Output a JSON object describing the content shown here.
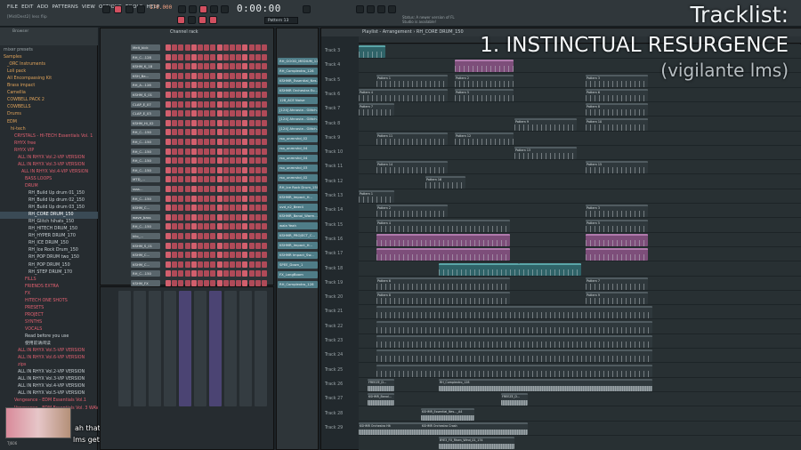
{
  "menubar": {
    "items": [
      "FILE",
      "EDIT",
      "ADD",
      "PATTERNS",
      "VIEW",
      "OPTIONS",
      "TOOLS",
      "HELP"
    ],
    "hint": "[Mid/Dest2] less flip",
    "tempo": "179.000",
    "clock": "0:00:00",
    "pattern": "Pattern 13",
    "news": "Status: A newer version of FL Studio is available!"
  },
  "overlay": {
    "heading": "Tracklist:",
    "title": "1. INSTINCTUAL RESURGENCE",
    "artist": "(vigilante lms)"
  },
  "subtitles": {
    "line1": "ah that's as far as vigilante",
    "line2": "lms gets today",
    "thumb_label": "TJ606"
  },
  "browser": {
    "title": "Browser",
    "items": [
      {
        "label": "mixer presets",
        "level": 0,
        "color": "#9aa4a8"
      },
      {
        "label": "Samples",
        "level": 0,
        "color": "#e0a35a"
      },
      {
        "label": "_ORC Instruments",
        "level": 1,
        "color": "#e0a35a"
      },
      {
        "label": "Loli pack",
        "level": 1,
        "color": "#e0a35a"
      },
      {
        "label": "All Encompassing Kit",
        "level": 1,
        "color": "#e0a35a"
      },
      {
        "label": "Brass impact",
        "level": 1,
        "color": "#e0a35a"
      },
      {
        "label": "Camellia",
        "level": 1,
        "color": "#e0a35a"
      },
      {
        "label": "COWBELL PACK 2",
        "level": 1,
        "color": "#e0a35a"
      },
      {
        "label": "COWBELLS",
        "level": 1,
        "color": "#e0a35a"
      },
      {
        "label": "Drums",
        "level": 1,
        "color": "#e0a35a"
      },
      {
        "label": "EDM",
        "level": 1,
        "color": "#e0a35a"
      },
      {
        "label": "hi-tech",
        "level": 2,
        "color": "#e0a35a"
      },
      {
        "label": "CRYSTALS - HI-TECH Essentials Vol. 1",
        "level": 3,
        "color": "#e06070"
      },
      {
        "label": "RHYX free",
        "level": 3,
        "color": "#e06070"
      },
      {
        "label": "RHYX VIP",
        "level": 3,
        "color": "#e06070"
      },
      {
        "label": "ALL IN RHYX Vol.2-VIP VERSION",
        "level": 4,
        "color": "#e06070"
      },
      {
        "label": "ALL IN RHYX Vol.3-VIP VERSION",
        "level": 4,
        "color": "#e06070"
      },
      {
        "label": "ALL IN RHYX Vol.4-VIP VERSION",
        "level": 5,
        "color": "#e06070"
      },
      {
        "label": "BASS LOOPS",
        "level": 6,
        "color": "#e06070"
      },
      {
        "label": "DRUM",
        "level": 6,
        "color": "#e06070"
      },
      {
        "label": "RH_Build Up drum 01_150",
        "level": 7,
        "color": "#c8d0d4"
      },
      {
        "label": "RH_Build Up drum 02_150",
        "level": 7,
        "color": "#c8d0d4"
      },
      {
        "label": "RH_Build Up drum 03_150",
        "level": 7,
        "color": "#c8d0d4"
      },
      {
        "label": "RH_CORE DRUM_150",
        "level": 7,
        "color": "#ffffff"
      },
      {
        "label": "RH_Glitch hihats_150",
        "level": 7,
        "color": "#c8d0d4"
      },
      {
        "label": "RH_HITECH DRUM_150",
        "level": 7,
        "color": "#c8d0d4"
      },
      {
        "label": "RH_HYPER DRUM_170",
        "level": 7,
        "color": "#c8d0d4"
      },
      {
        "label": "RH_ICE DRUM_150",
        "level": 7,
        "color": "#c8d0d4"
      },
      {
        "label": "RH_Ice Rock Drum_150",
        "level": 7,
        "color": "#c8d0d4"
      },
      {
        "label": "RH_POP DRUM two_150",
        "level": 7,
        "color": "#c8d0d4"
      },
      {
        "label": "RH_POP DRUM_150",
        "level": 7,
        "color": "#c8d0d4"
      },
      {
        "label": "RH_STEP DRUM_170",
        "level": 7,
        "color": "#c8d0d4"
      },
      {
        "label": "FILLS",
        "level": 6,
        "color": "#e06070"
      },
      {
        "label": "FRIENDS EXTRA",
        "level": 6,
        "color": "#e06070"
      },
      {
        "label": "FX",
        "level": 6,
        "color": "#e06070"
      },
      {
        "label": "HITECH ONE SHOTS",
        "level": 6,
        "color": "#e06070"
      },
      {
        "label": "PRESETS",
        "level": 6,
        "color": "#e06070"
      },
      {
        "label": "PROJECT",
        "level": 6,
        "color": "#e06070"
      },
      {
        "label": "SYNTHS",
        "level": 6,
        "color": "#e06070"
      },
      {
        "label": "VOCALS",
        "level": 6,
        "color": "#e06070"
      },
      {
        "label": "Read before you use",
        "level": 6,
        "color": "#c8d0d4"
      },
      {
        "label": "使用前请阅读",
        "level": 6,
        "color": "#c8d0d4"
      },
      {
        "label": "ALL IN RHYX Vol.5-VIP VERSION",
        "level": 4,
        "color": "#e06070"
      },
      {
        "label": "ALL IN RHYX Vol.6-VIP VERSION",
        "level": 4,
        "color": "#e06070"
      },
      {
        "label": "zips",
        "level": 4,
        "color": "#e06070"
      },
      {
        "label": "ALL IN RHYX Vol.2-VIP VERSION",
        "level": 4,
        "color": "#c8d0d4"
      },
      {
        "label": "ALL IN RHYX Vol.3-VIP VERSION",
        "level": 4,
        "color": "#c8d0d4"
      },
      {
        "label": "ALL IN RHYX Vol.4-VIP VERSION",
        "level": 4,
        "color": "#c8d0d4"
      },
      {
        "label": "ALL IN RHYX Vol.5-VIP VERSION",
        "level": 4,
        "color": "#c8d0d4"
      },
      {
        "label": "Vengeance - EDM Essentials Vol.1",
        "level": 3,
        "color": "#e06070"
      },
      {
        "label": "Vengeance - EDM Essentials Vol. 3 WAV",
        "level": 3,
        "color": "#e06070"
      }
    ]
  },
  "channel_rack": {
    "title": "Channel rack",
    "channels": [
      "Melt_kick",
      "RH_C...128",
      "KSHM_K_18",
      "KSH_Ba...",
      "RH_A...128",
      "KSHM_S_01",
      "CLAP_E_07",
      "CLAP_E_03",
      "KSHM_Hi_02",
      "RH_C...150",
      "RH_C...150",
      "RH_C...150",
      "RH_C...150",
      "RH_C...150",
      "MTD_...",
      "ssss...",
      "RH_C...150",
      "KSHM_C...",
      "wave_bass",
      "RH_C...150",
      "kilo_...",
      "KSHM_S_01",
      "KSHM_C...",
      "KSHM_C...",
      "RH_C...150",
      "KSHM_FX"
    ]
  },
  "playlist": {
    "title": "Playlist - Arrangement › RH_CORE DRUM_150",
    "track_names": [
      "Track 3",
      "Track 4",
      "Track 5",
      "Track 6",
      "Track 7",
      "Track 8",
      "Track 9",
      "Track 10",
      "Track 11",
      "Track 12",
      "Track 13",
      "Track 14",
      "Track 15",
      "Track 16",
      "Track 17",
      "Track 18",
      "Track 19",
      "Track 20",
      "Track 21",
      "Track 22",
      "Track 23",
      "Track 24",
      "Track 25",
      "Track 26",
      "Track 27",
      "Track 28",
      "Track 29"
    ],
    "patterns": [
      "RH_GOOD_MEDIUM_128",
      "RH_Complextro_128",
      "KSHMR_Essential_Nes...",
      "KSHMR Orchestra Eu...",
      "128_ACE Noise",
      "[124] Ahnovia - Glitch...",
      "[124] Ahnovia - Glitch...",
      "[124] Ahnovia - Glitch...",
      "rso_unmrshd_02",
      "rso_unmrshd_04",
      "rso_unmrshd_04",
      "rso_unmrshd_03",
      "rso_unmrshd_02",
      "RH_Ice Rock Drum_150",
      "KSHMR_Impact_H...",
      "uvd_n2_Beer4",
      "KSHMR_Banol_Warm...",
      "wala Yeah",
      "KSHMR_PROJECT_C...",
      "KSHMR_Impact_H...",
      "KSHMR Impact_Sw...",
      "SPEE_Down_1",
      "FX_LongBoom",
      "RH_Complextro_128"
    ],
    "clip_labels": [
      "Pattern 1",
      "Pattern 2",
      "Pattern 3",
      "Pattern 4",
      "Pattern 5",
      "Pattern 6",
      "Pattern 7",
      "Pattern 8",
      "Pattern 9",
      "Pattern 10",
      "Pattern 11",
      "Pattern 12",
      "Pattern 13",
      "Pattern 14",
      "Pattern 15",
      "Pattern 16"
    ],
    "audio_labels": [
      "FREEZE_D...",
      "KSHMR_Banol...",
      "RH_Complextro_128",
      "KSHMR_Essential_Nes..._A4",
      "KSHMR Orchestra Hit",
      "KSHMR Orchestra Crash",
      "BYE3_FX_Risen_Wind_01_174"
    ]
  }
}
